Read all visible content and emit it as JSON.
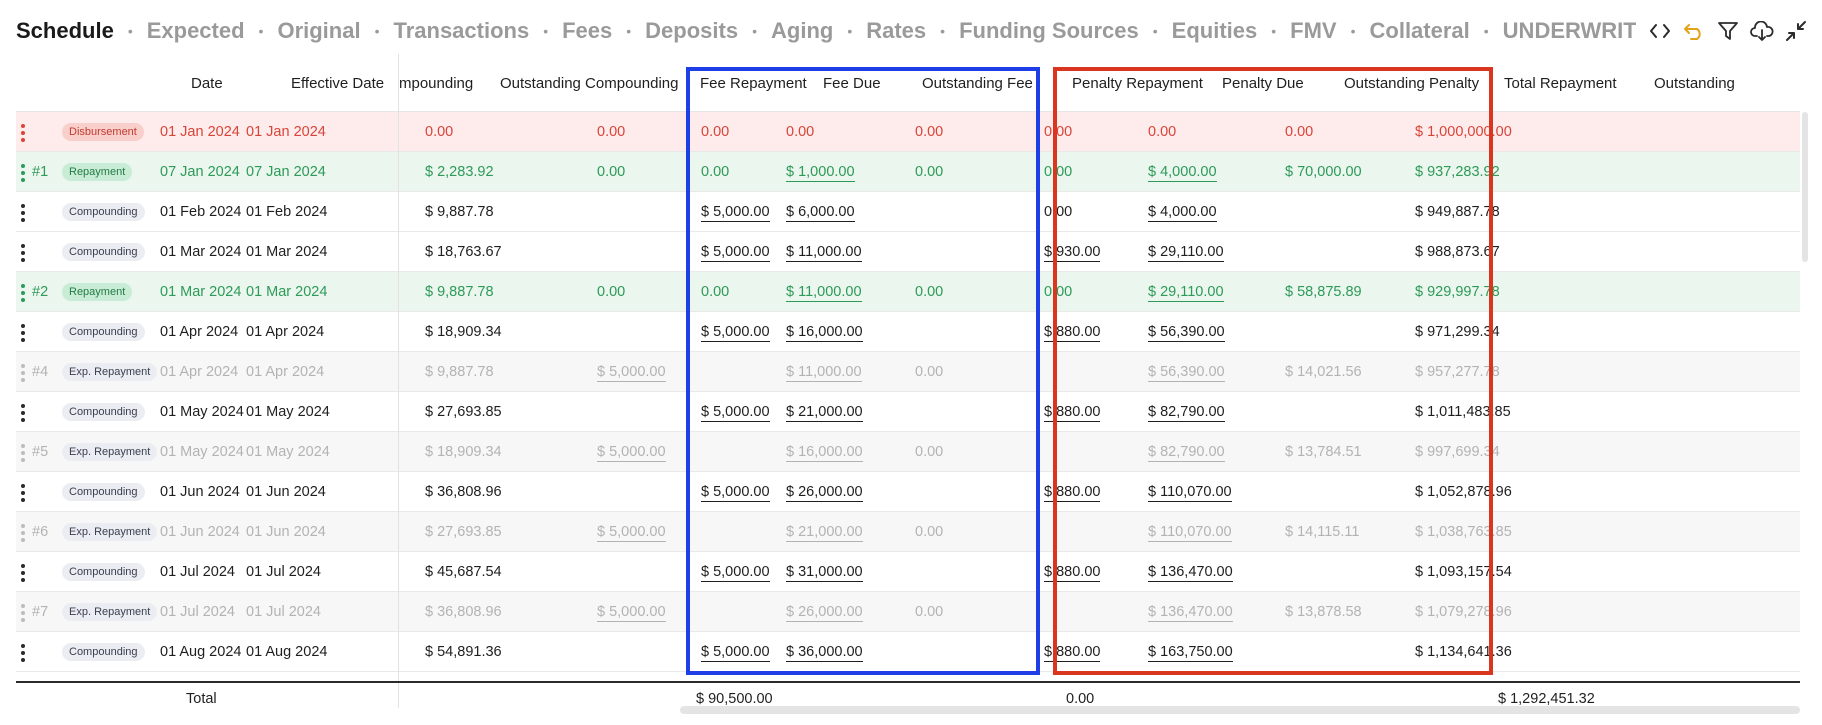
{
  "tabs": [
    {
      "label": "Schedule",
      "active": true
    },
    {
      "label": "Expected"
    },
    {
      "label": "Original"
    },
    {
      "label": "Transactions"
    },
    {
      "label": "Fees"
    },
    {
      "label": "Deposits"
    },
    {
      "label": "Aging"
    },
    {
      "label": "Rates"
    },
    {
      "label": "Funding Sources"
    },
    {
      "label": "Equities"
    },
    {
      "label": "FMV"
    },
    {
      "label": "Collateral"
    },
    {
      "label": "UNDERWRITII"
    }
  ],
  "tab_separator": "•",
  "toolbar_icons": [
    "code-icon",
    "undo-icon",
    "filter-icon",
    "cloud-download-icon",
    "collapse-icon"
  ],
  "colors": {
    "disbursement_text": "#d9443a",
    "repayment_text": "#2e9a58",
    "expected_text": "#b3b3b3",
    "highlight_blue": "#1e3ee8",
    "highlight_red": "#d9351f",
    "undo_icon": "#e3a21a"
  },
  "columns": {
    "date": "Date",
    "effective_date": "Effective Date",
    "compounding": "mpounding",
    "outstanding_compounding": "Outstanding Compounding",
    "fee_repayment": "Fee Repayment",
    "fee_due": "Fee Due",
    "outstanding_fee": "Outstanding Fee",
    "penalty_repayment": "Penalty Repayment",
    "penalty_due": "Penalty Due",
    "outstanding_penalty": "Outstanding Penalty",
    "total_repayment": "Total Repayment",
    "outstanding": "Outstanding"
  },
  "rows": [
    {
      "kind": "disb",
      "num": "",
      "type": "Disbursement",
      "date": "01 Jan 2024",
      "eff": "01 Jan 2024",
      "out_comp": "0.00",
      "fee_rep": "0.00",
      "fee_due": "0.00",
      "out_fee": "0.00",
      "pen_rep": "0.00",
      "pen_due": "0.00",
      "out_pen": "0.00",
      "tot_rep": "0.00",
      "outstanding": "$ 1,000,000.00"
    },
    {
      "kind": "rep",
      "num": "#1",
      "type": "Repayment",
      "date": "07 Jan 2024",
      "eff": "07 Jan 2024",
      "out_comp": "$ 2,283.92",
      "fee_rep": "0.00",
      "fee_due": "0.00",
      "out_fee": "$ 1,000.00",
      "pen_rep": "0.00",
      "pen_due": "0.00",
      "out_pen": "$ 4,000.00",
      "tot_rep": "$ 70,000.00",
      "outstanding": "$ 937,283.92"
    },
    {
      "kind": "comp",
      "num": "",
      "type": "Compounding",
      "date": "01 Feb 2024",
      "eff": "01 Feb 2024",
      "out_comp": "$ 9,887.78",
      "fee_rep": "",
      "fee_due": "$ 5,000.00",
      "out_fee": "$ 6,000.00",
      "pen_rep": "",
      "pen_due": "0.00",
      "out_pen": "$ 4,000.00",
      "tot_rep": "",
      "outstanding": "$ 949,887.78"
    },
    {
      "kind": "comp",
      "num": "",
      "type": "Compounding",
      "date": "01 Mar 2024",
      "eff": "01 Mar 2024",
      "out_comp": "$ 18,763.67",
      "fee_rep": "",
      "fee_due": "$ 5,000.00",
      "out_fee": "$ 11,000.00",
      "pen_rep": "",
      "pen_due": "$ 930.00",
      "out_pen": "$ 29,110.00",
      "tot_rep": "",
      "outstanding": "$ 988,873.67"
    },
    {
      "kind": "rep",
      "num": "#2",
      "type": "Repayment",
      "date": "01 Mar 2024",
      "eff": "01 Mar 2024",
      "out_comp": "$ 9,887.78",
      "fee_rep": "0.00",
      "fee_due": "0.00",
      "out_fee": "$ 11,000.00",
      "pen_rep": "0.00",
      "pen_due": "0.00",
      "out_pen": "$ 29,110.00",
      "tot_rep": "$ 58,875.89",
      "outstanding": "$ 929,997.78"
    },
    {
      "kind": "comp",
      "num": "",
      "type": "Compounding",
      "date": "01 Apr 2024",
      "eff": "01 Apr 2024",
      "out_comp": "$ 18,909.34",
      "fee_rep": "",
      "fee_due": "$ 5,000.00",
      "out_fee": "$ 16,000.00",
      "pen_rep": "",
      "pen_due": "$ 880.00",
      "out_pen": "$ 56,390.00",
      "tot_rep": "",
      "outstanding": "$ 971,299.34"
    },
    {
      "kind": "exp",
      "num": "#4",
      "type": "Exp. Repayment",
      "date": "01 Apr 2024",
      "eff": "01 Apr 2024",
      "out_comp": "$ 9,887.78",
      "fee_rep": "$ 5,000.00",
      "fee_due": "",
      "out_fee": "$ 11,000.00",
      "pen_rep": "0.00",
      "pen_due": "",
      "out_pen": "$ 56,390.00",
      "tot_rep": "$ 14,021.56",
      "outstanding": "$ 957,277.78"
    },
    {
      "kind": "comp",
      "num": "",
      "type": "Compounding",
      "date": "01 May 2024",
      "eff": "01 May 2024",
      "out_comp": "$ 27,693.85",
      "fee_rep": "",
      "fee_due": "$ 5,000.00",
      "out_fee": "$ 21,000.00",
      "pen_rep": "",
      "pen_due": "$ 880.00",
      "out_pen": "$ 82,790.00",
      "tot_rep": "",
      "outstanding": "$ 1,011,483.85"
    },
    {
      "kind": "exp",
      "num": "#5",
      "type": "Exp. Repayment",
      "date": "01 May 2024",
      "eff": "01 May 2024",
      "out_comp": "$ 18,909.34",
      "fee_rep": "$ 5,000.00",
      "fee_due": "",
      "out_fee": "$ 16,000.00",
      "pen_rep": "0.00",
      "pen_due": "",
      "out_pen": "$ 82,790.00",
      "tot_rep": "$ 13,784.51",
      "outstanding": "$ 997,699.34"
    },
    {
      "kind": "comp",
      "num": "",
      "type": "Compounding",
      "date": "01 Jun 2024",
      "eff": "01 Jun 2024",
      "out_comp": "$ 36,808.96",
      "fee_rep": "",
      "fee_due": "$ 5,000.00",
      "out_fee": "$ 26,000.00",
      "pen_rep": "",
      "pen_due": "$ 880.00",
      "out_pen": "$ 110,070.00",
      "tot_rep": "",
      "outstanding": "$ 1,052,878.96"
    },
    {
      "kind": "exp",
      "num": "#6",
      "type": "Exp. Repayment",
      "date": "01 Jun 2024",
      "eff": "01 Jun 2024",
      "out_comp": "$ 27,693.85",
      "fee_rep": "$ 5,000.00",
      "fee_due": "",
      "out_fee": "$ 21,000.00",
      "pen_rep": "0.00",
      "pen_due": "",
      "out_pen": "$ 110,070.00",
      "tot_rep": "$ 14,115.11",
      "outstanding": "$ 1,038,763.85"
    },
    {
      "kind": "comp",
      "num": "",
      "type": "Compounding",
      "date": "01 Jul 2024",
      "eff": "01 Jul 2024",
      "out_comp": "$ 45,687.54",
      "fee_rep": "",
      "fee_due": "$ 5,000.00",
      "out_fee": "$ 31,000.00",
      "pen_rep": "",
      "pen_due": "$ 880.00",
      "out_pen": "$ 136,470.00",
      "tot_rep": "",
      "outstanding": "$ 1,093,157.54"
    },
    {
      "kind": "exp",
      "num": "#7",
      "type": "Exp. Repayment",
      "date": "01 Jul 2024",
      "eff": "01 Jul 2024",
      "out_comp": "$ 36,808.96",
      "fee_rep": "$ 5,000.00",
      "fee_due": "",
      "out_fee": "$ 26,000.00",
      "pen_rep": "0.00",
      "pen_due": "",
      "out_pen": "$ 136,470.00",
      "tot_rep": "$ 13,878.58",
      "outstanding": "$ 1,079,278.96"
    },
    {
      "kind": "comp",
      "num": "",
      "type": "Compounding",
      "date": "01 Aug 2024",
      "eff": "01 Aug 2024",
      "out_comp": "$ 54,891.36",
      "fee_rep": "",
      "fee_due": "$ 5,000.00",
      "out_fee": "$ 36,000.00",
      "pen_rep": "",
      "pen_due": "$ 880.00",
      "out_pen": "$ 163,750.00",
      "tot_rep": "",
      "outstanding": "$ 1,134,641.36"
    }
  ],
  "totals": {
    "label": "Total",
    "fee_repayment": "$ 90,500.00",
    "penalty_repayment": "0.00",
    "total_repayment": "$ 1,292,451.32"
  }
}
